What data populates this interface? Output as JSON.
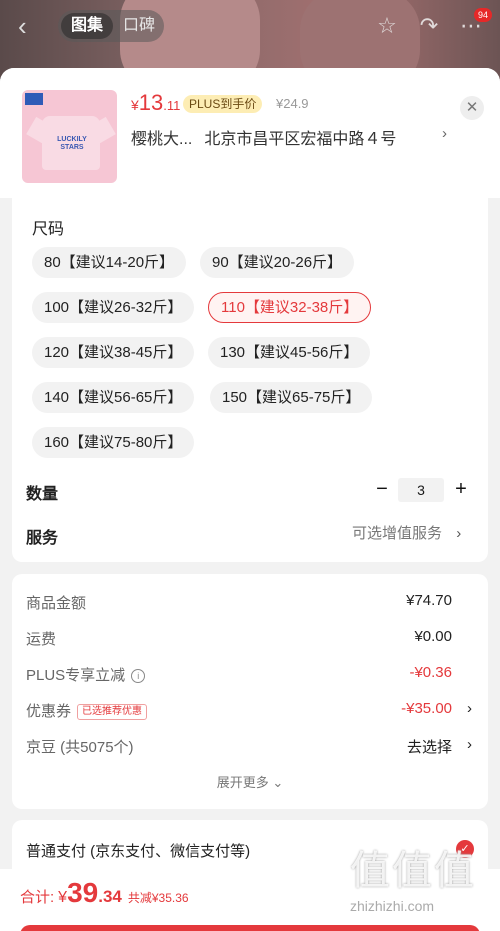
{
  "nav": {
    "badge_text": "",
    "tabs": [
      "图集",
      "口碑"
    ],
    "cart_count": "94"
  },
  "product": {
    "price_symbol": "¥",
    "price_int": "13",
    "price_dec": ".11",
    "plus_tag": "PLUS到手价",
    "original_price": "¥24.9",
    "address_name": "樱桃大...",
    "address": "北京市昌平区宏福中路４号",
    "thumb_text": "LUCKILY STARS"
  },
  "size": {
    "title": "尺码",
    "options": [
      "80【建议14-20斤】",
      "90【建议20-26斤】",
      "100【建议26-32斤】",
      "110【建议32-38斤】",
      "120【建议38-45斤】",
      "130【建议45-56斤】",
      "140【建议56-65斤】",
      "150【建议65-75斤】",
      "160【建议75-80斤】"
    ],
    "selected": "110【建议32-38斤】"
  },
  "quantity": {
    "label": "数量",
    "value": "3",
    "minus": "−",
    "plus": "+"
  },
  "service": {
    "label": "服务",
    "value": "可选增值服务"
  },
  "fees": {
    "goods_label": "商品金额",
    "goods_value": "¥74.70",
    "shipping_label": "运费",
    "shipping_value": "¥0.00",
    "plus_label": "PLUS专享立减",
    "plus_value": "-¥0.36",
    "coupon_label": "优惠券",
    "coupon_tag": "已选推荐优惠",
    "coupon_value": "-¥35.00",
    "jingdou_label": "京豆 (共5075个)",
    "jingdou_value": "去选择",
    "expand": "展开更多"
  },
  "payment": {
    "label": "普通支付 (京东支付、微信支付等)"
  },
  "total": {
    "label": "合计:",
    "symbol": "¥",
    "int": "39",
    "dec": ".34",
    "saved": "共减¥35.36"
  },
  "watermark": {
    "big": "值值值",
    "small": "zhizhizhi.com"
  },
  "colors": {
    "accent": "#e4393c",
    "plus_tag_bg": "#fdedb4"
  }
}
